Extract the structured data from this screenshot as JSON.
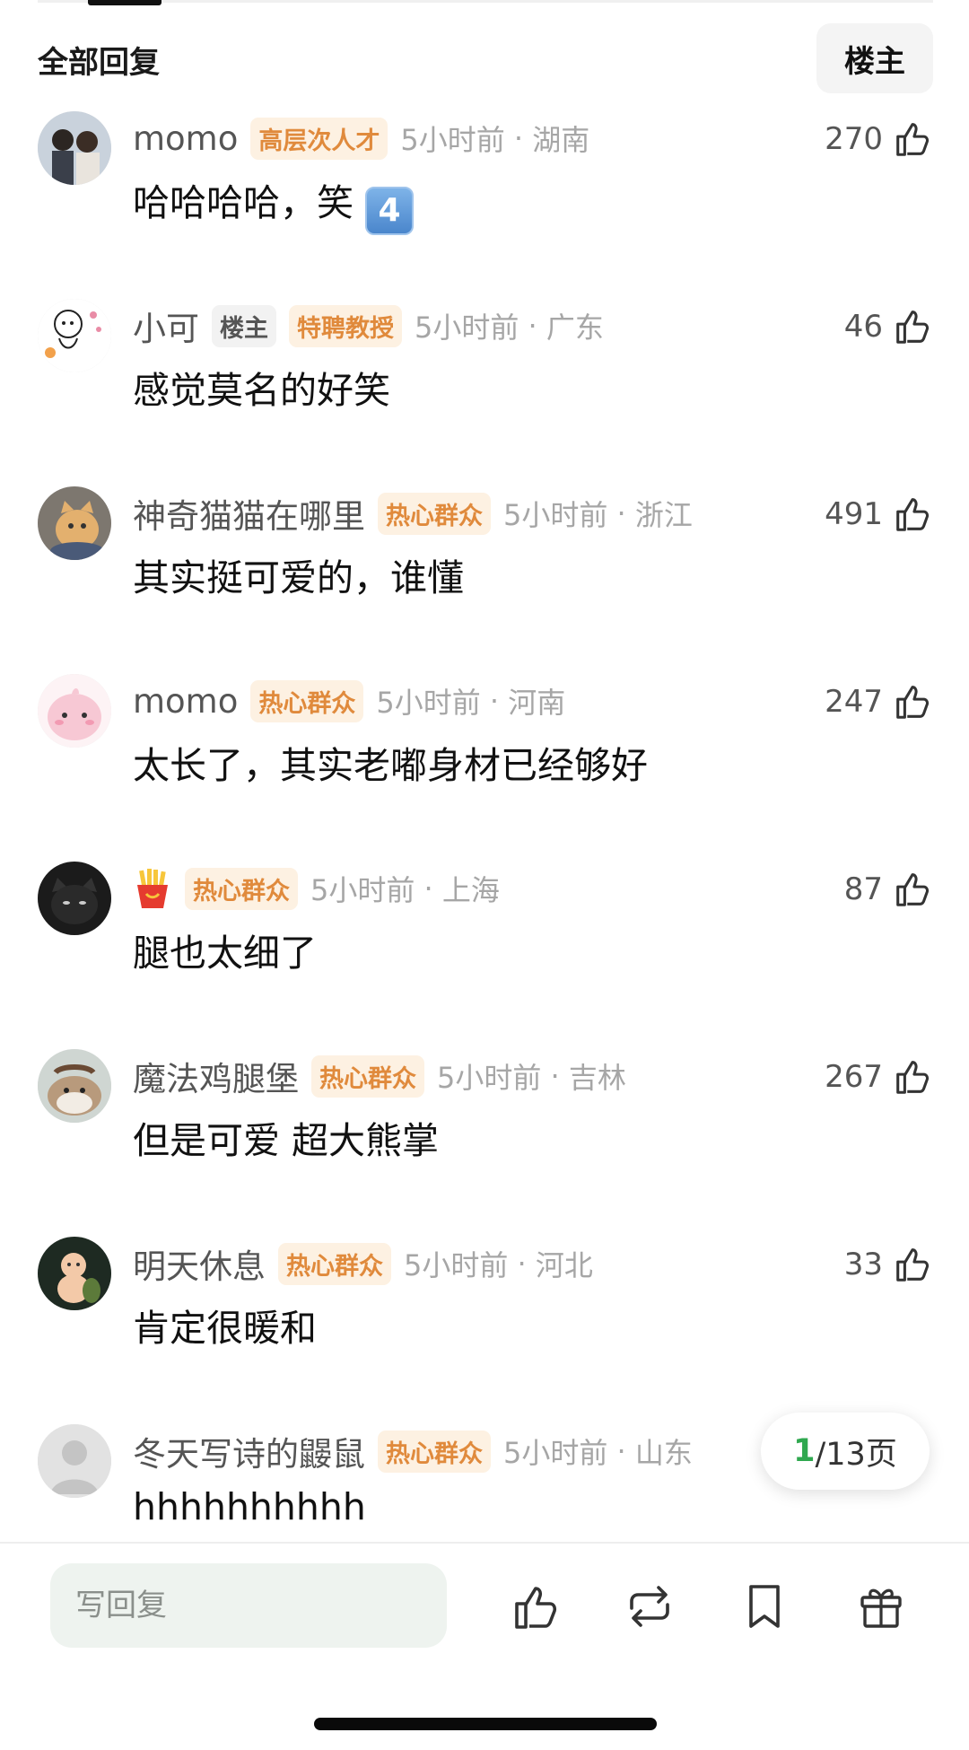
{
  "header": {
    "title": "全部回复",
    "owner_filter": "楼主"
  },
  "comments": [
    {
      "username": "momo",
      "owner_badge": "",
      "badge": "高层次人才",
      "time": "5小时前",
      "location": "湖南",
      "likes": "270",
      "text": "哈哈哈哈，笑",
      "emoji": "4",
      "avatar": "couple-photo-avatar"
    },
    {
      "username": "小可",
      "owner_badge": "楼主",
      "badge": "特聘教授",
      "time": "5小时前",
      "location": "广东",
      "likes": "46",
      "text": "感觉莫名的好笑",
      "avatar": "sketch-character-avatar"
    },
    {
      "username": "神奇猫猫在哪里",
      "owner_badge": "",
      "badge": "热心群众",
      "time": "5小时前",
      "location": "浙江",
      "likes": "491",
      "text": "其实挺可爱的，谁懂",
      "avatar": "cat-photo-avatar"
    },
    {
      "username": "momo",
      "owner_badge": "",
      "badge": "热心群众",
      "time": "5小时前",
      "location": "河南",
      "likes": "247",
      "text": "太长了，其实老嘟身材已经够好",
      "avatar": "pink-blob-avatar"
    },
    {
      "username": "",
      "owner_badge": "",
      "badge": "热心群众",
      "time": "5小时前",
      "location": "上海",
      "likes": "87",
      "text": "腿也太细了",
      "avatar": "black-cat-avatar",
      "name_icon": "fries-icon"
    },
    {
      "username": "魔法鸡腿堡",
      "owner_badge": "",
      "badge": "热心群众",
      "time": "5小时前",
      "location": "吉林",
      "likes": "267",
      "text": "但是可爱 超大熊掌",
      "avatar": "hamster-photo-avatar"
    },
    {
      "username": "明天休息",
      "owner_badge": "",
      "badge": "热心群众",
      "time": "5小时前",
      "location": "河北",
      "likes": "33",
      "text": "肯定很暖和",
      "avatar": "baby-figure-avatar"
    },
    {
      "username": "冬天写诗的鼹鼠",
      "owner_badge": "",
      "badge": "热心群众",
      "time": "5小时前",
      "location": "山东",
      "likes": "",
      "text": "hhhhhhhhhh",
      "avatar": "default-user-avatar"
    }
  ],
  "pager": {
    "current": "1",
    "total_text": "/13页"
  },
  "composer": {
    "placeholder": "写回复"
  },
  "actions": [
    "like-icon",
    "repost-icon",
    "bookmark-icon",
    "gift-icon"
  ],
  "colors": {
    "badge_text": "#e08a3c",
    "badge_bg": "#fdf1e2",
    "pager_current": "#2fa84f",
    "composer_bg": "#eef3ef"
  }
}
